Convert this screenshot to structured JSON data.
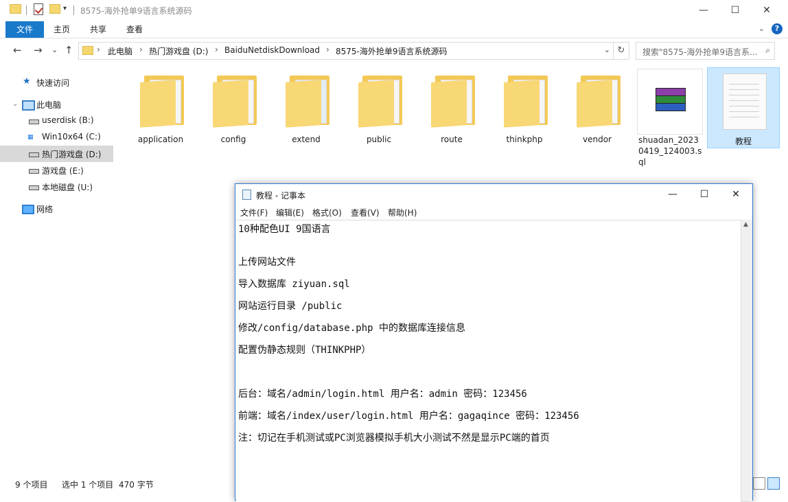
{
  "window": {
    "title": "8575-海外抢单9语言系统源码",
    "minimize": "—",
    "maximize": "☐",
    "close": "✕"
  },
  "ribbon": {
    "tabs": [
      "文件",
      "主页",
      "共享",
      "查看"
    ],
    "active_tab": "文件",
    "help": "?"
  },
  "address": {
    "crumbs": [
      "此电脑",
      "热门游戏盘 (D:)",
      "BaiduNetdiskDownload",
      "8575-海外抢单9语言系统源码"
    ],
    "search_placeholder": "搜索\"8575-海外抢单9语言系...",
    "back": "←",
    "forward": "→",
    "up": "↑",
    "recent": "⌄",
    "refresh": "↻",
    "dropdown": "⌄"
  },
  "sidebar": {
    "items": [
      {
        "label": "快速访问",
        "icon": "star-icon"
      },
      {
        "label": "此电脑",
        "icon": "computer-icon"
      },
      {
        "label": "userdisk (B:)",
        "icon": "drive-icon"
      },
      {
        "label": "Win10x64 (C:)",
        "icon": "windows-drive-icon"
      },
      {
        "label": "热门游戏盘 (D:)",
        "icon": "drive-icon",
        "selected": true
      },
      {
        "label": "游戏盘 (E:)",
        "icon": "drive-icon"
      },
      {
        "label": "本地磁盘 (U:)",
        "icon": "drive-icon"
      },
      {
        "label": "网络",
        "icon": "network-icon"
      }
    ]
  },
  "files": [
    {
      "name": "application",
      "type": "folder"
    },
    {
      "name": "config",
      "type": "folder"
    },
    {
      "name": "extend",
      "type": "folder"
    },
    {
      "name": "public",
      "type": "folder"
    },
    {
      "name": "route",
      "type": "folder"
    },
    {
      "name": "thinkphp",
      "type": "folder"
    },
    {
      "name": "vendor",
      "type": "folder"
    },
    {
      "name": "shuadan_20230419_124003.sql",
      "type": "archive"
    },
    {
      "name": "教程",
      "type": "text",
      "selected": true
    }
  ],
  "status": {
    "item_count": "9 个项目",
    "selection": "选中 1 个项目",
    "size": "470 字节"
  },
  "notepad": {
    "title": "教程 - 记事本",
    "menu": [
      "文件(F)",
      "编辑(E)",
      "格式(O)",
      "查看(V)",
      "帮助(H)"
    ],
    "minimize": "—",
    "maximize": "☐",
    "close": "✕",
    "lines": [
      "10种配色UI 9国语言",
      "",
      "上传网站文件",
      "导入数据库 ziyuan.sql",
      "网站运行目录 /public",
      "修改/config/database.php 中的数据库连接信息",
      "配置伪静态规则（THINKPHP）",
      "",
      "后台：域名/admin/login.html  用户名：admin  密码：123456",
      "前端：域名/index/user/login.html  用户名：gagaqince 密码：123456",
      "注：切记在手机测试或PC浏览器模拟手机大小测试不然是显示PC端的首页"
    ]
  },
  "colors": {
    "accent": "#1979ca",
    "selection": "#cce8ff",
    "folder": "#f8d775"
  }
}
